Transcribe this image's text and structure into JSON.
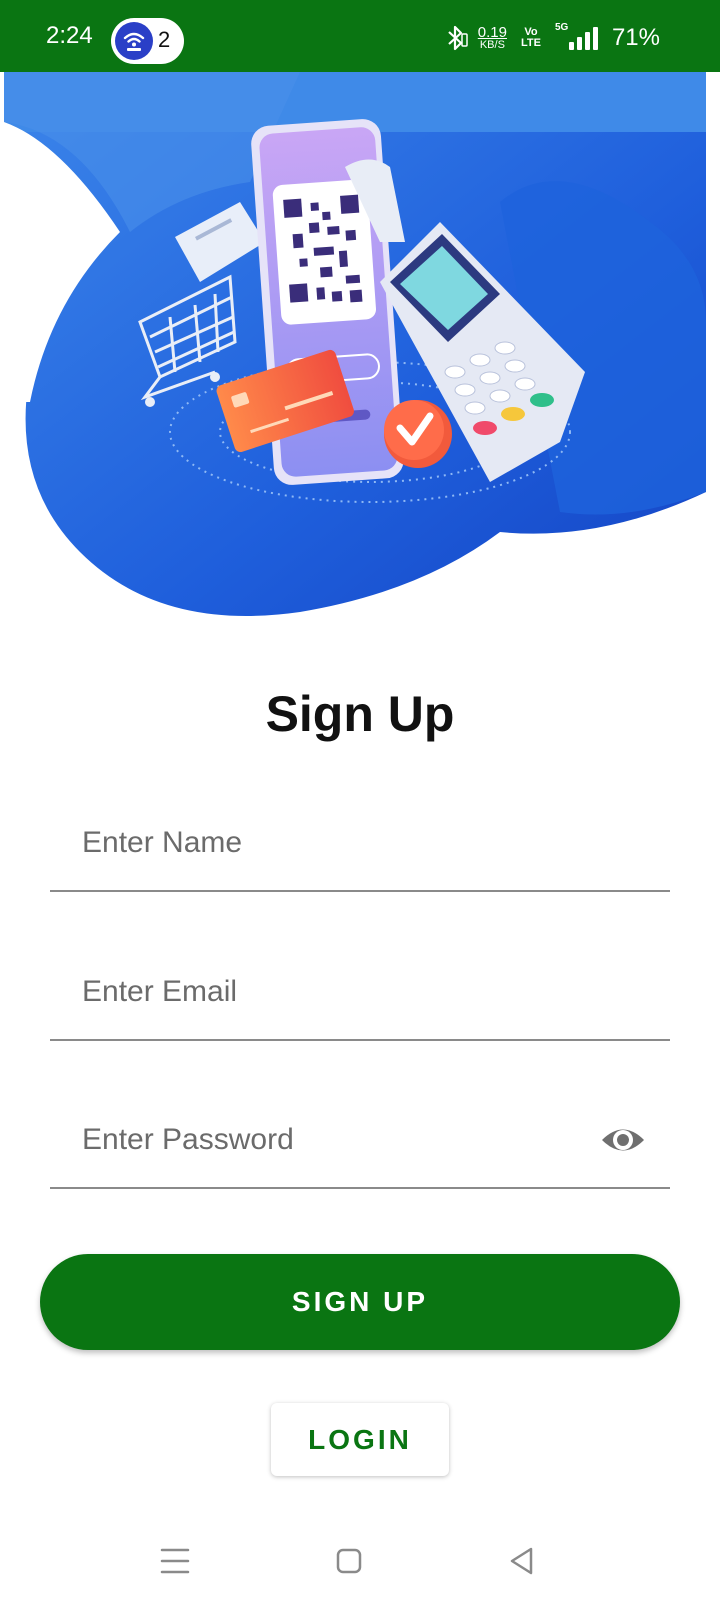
{
  "status_bar": {
    "time": "2:24",
    "hotspot_count": "2",
    "net_speed_value": "0.19",
    "net_speed_unit": "KB/S",
    "volte_top": "Vo",
    "volte_bottom": "LTE",
    "network_type": "5G",
    "battery": "71%",
    "icons": [
      "hotspot-icon",
      "bluetooth-icon",
      "signal-icon"
    ]
  },
  "hero": {
    "illustration": "mobile-payment-illustration",
    "colors": {
      "blob_dark": "#1a4fcf",
      "blob_light": "#3d8fe8"
    }
  },
  "form": {
    "title": "Sign Up",
    "name_placeholder": "Enter Name",
    "email_placeholder": "Enter Email",
    "password_placeholder": "Enter Password",
    "password_toggle_icon": "eye-icon"
  },
  "actions": {
    "signup_label": "SIGN UP",
    "login_label": "LOGIN"
  },
  "nav_bar": {
    "icons": [
      "menu-icon",
      "home-icon",
      "back-icon"
    ]
  },
  "colors": {
    "primary_green": "#0a7512",
    "text_dark": "#111111",
    "placeholder": "#6b6b6b",
    "underline": "#8a8a8a"
  }
}
